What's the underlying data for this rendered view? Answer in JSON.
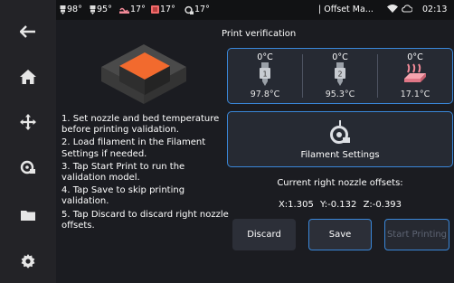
{
  "statusbar": {
    "nozzle1_temp": "98°",
    "nozzle2_temp": "95°",
    "bed_temp": "17°",
    "chamber_temp": "17°",
    "filament_temp": "17°",
    "page_name": "| Offset Ma...",
    "time": "02:13"
  },
  "sidebar": {
    "items": [
      {
        "name": "back",
        "icon": "back-arrow-icon"
      },
      {
        "name": "home",
        "icon": "home-icon"
      },
      {
        "name": "move",
        "icon": "move-arrows-icon"
      },
      {
        "name": "extruder",
        "icon": "extruder-icon"
      },
      {
        "name": "files",
        "icon": "folder-icon"
      },
      {
        "name": "settings",
        "icon": "gear-icon"
      }
    ]
  },
  "page": {
    "title": "Print verification",
    "instructions": [
      "1. Set nozzle and bed temperature before printing validation.",
      "2. Load filament in the Filament Settings if needed.",
      "3. Tap Start Print to run the validation model.",
      "4. Tap Save to skip printing validation.",
      "5. Tap Discard to discard right nozzle offsets."
    ]
  },
  "temperatures": {
    "nozzle_left": {
      "target": "0°C",
      "current": "97.8°C",
      "label": "1"
    },
    "nozzle_right": {
      "target": "0°C",
      "current": "95.3°C",
      "label": "2"
    },
    "bed": {
      "target": "0°C",
      "current": "17.1°C"
    }
  },
  "filament_button": {
    "label": "Filament Settings"
  },
  "offsets": {
    "title": "Current right nozzle offsets:",
    "x": "X:1.305",
    "y": "Y:-0.132",
    "z": "Z:-0.393"
  },
  "buttons": {
    "discard": "Discard",
    "save": "Save",
    "start": "Start Printing"
  },
  "colors": {
    "accent": "#3a87d9",
    "model_top": "#f26a2e",
    "bed_heater": "#f28a98"
  }
}
